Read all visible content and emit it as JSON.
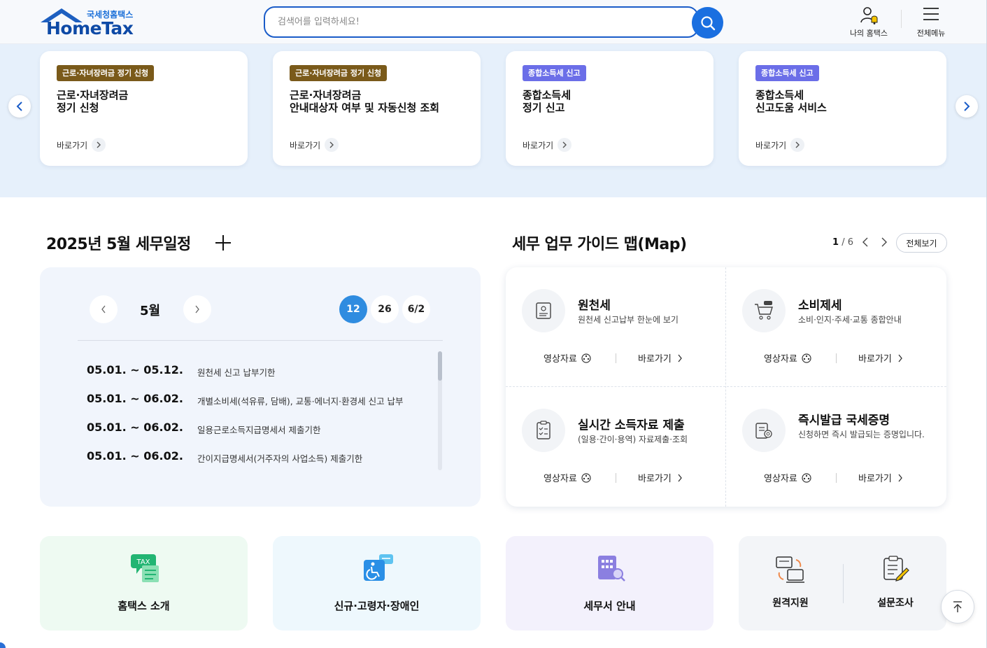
{
  "header": {
    "logo_sub": "국세청홈택스",
    "logo_main": "HomeTax",
    "search_placeholder": "검색어를 입력하세요!",
    "my_hometax": "나의 홈택스",
    "all_menu": "전체메뉴"
  },
  "banner": {
    "cards": [
      {
        "badge": "근로·자녀장려금 정기 신청",
        "badge_color": "#7a5a1a",
        "title": "근로·자녀장려금\n정기 신청",
        "go": "바로가기"
      },
      {
        "badge": "근로·자녀장려금 정기 신청",
        "badge_color": "#7a5a1a",
        "title": "근로·자녀장려금\n안내대상자 여부 및 자동신청 조회",
        "go": "바로가기"
      },
      {
        "badge": "종합소득세 신고",
        "badge_color": "#6b6ee8",
        "title": "종합소득세\n정기 신고",
        "go": "바로가기"
      },
      {
        "badge": "종합소득세 신고",
        "badge_color": "#6b6ee8",
        "title": "종합소득세\n신고도움 서비스",
        "go": "바로가기"
      }
    ]
  },
  "schedule": {
    "title": "2025년 5월 세무일정",
    "month": "5월",
    "days": [
      "12",
      "26",
      "6/2"
    ],
    "active_day": "12",
    "items": [
      {
        "date": "05.01. ~ 05.12.",
        "desc": "원천세 신고 납부기한"
      },
      {
        "date": "05.01. ~ 06.02.",
        "desc": "개별소비세(석유류, 담배), 교통·에너지·환경세 신고 납부"
      },
      {
        "date": "05.01. ~ 06.02.",
        "desc": "일용근로소득지급명세서 제출기한"
      },
      {
        "date": "05.01. ~ 06.02.",
        "desc": "간이지급명세서(거주자의 사업소득) 제출기한"
      }
    ]
  },
  "guide": {
    "title": "세무 업무 가이드 맵(Map)",
    "page_current": "1",
    "page_total": "/ 6",
    "view_all": "전체보기",
    "video_label": "영상자료",
    "go_label": "바로가기",
    "items": [
      {
        "title": "원천세",
        "desc": "원천세 신고납부 한눈에 보기",
        "icon": "document-icon"
      },
      {
        "title": "소비제세",
        "desc": "소비·인지·주세·교통 종합안내",
        "icon": "tax-cart-icon"
      },
      {
        "title": "실시간 소득자료 제출",
        "desc": "(일용·간이·용역) 자료제출·조회",
        "icon": "checklist-icon"
      },
      {
        "title": "즉시발급 국세증명",
        "desc": "신청하면 즉시 발급되는 증명입니다.",
        "icon": "certificate-icon"
      }
    ]
  },
  "tiles": {
    "intro": "홈택스 소개",
    "accessibility": "신규·고령자·장애인",
    "office": "세무서 안내",
    "remote": "원격지원",
    "survey": "설문조사"
  },
  "colors": {
    "primary": "#1a6fe0",
    "banner_bg": "#e6f0fb",
    "brown_badge": "#7a5a1a",
    "purple_badge": "#6b6ee8"
  }
}
